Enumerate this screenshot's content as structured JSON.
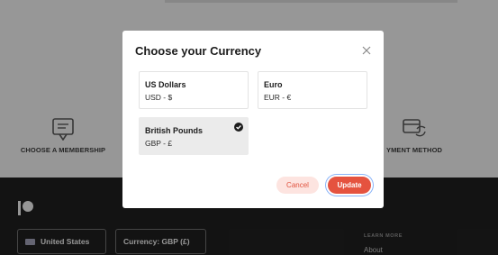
{
  "background": {
    "steps": [
      {
        "label": "CHOOSE A MEMBERSHIP",
        "icon": "membership-card-icon"
      },
      {
        "label": "YMENT METHOD",
        "icon": "payment-method-icon"
      }
    ],
    "footer": {
      "logo_icon": "patreon-logo-icon",
      "country_label": "United States",
      "currency_label": "Currency: GBP (£)",
      "learn_more_heading": "LEARN MORE",
      "about_link": "About"
    }
  },
  "modal": {
    "title": "Choose your Currency",
    "close_icon": "close-icon",
    "options": [
      {
        "name": "US Dollars",
        "code": "USD - $",
        "selected": false
      },
      {
        "name": "Euro",
        "code": "EUR - €",
        "selected": false
      },
      {
        "name": "British Pounds",
        "code": "GBP - £",
        "selected": true
      }
    ],
    "cancel_label": "Cancel",
    "update_label": "Update"
  },
  "colors": {
    "accent": "#e5533f",
    "accent_soft": "#fde4e0",
    "footer_bg": "#1e1e1e"
  }
}
